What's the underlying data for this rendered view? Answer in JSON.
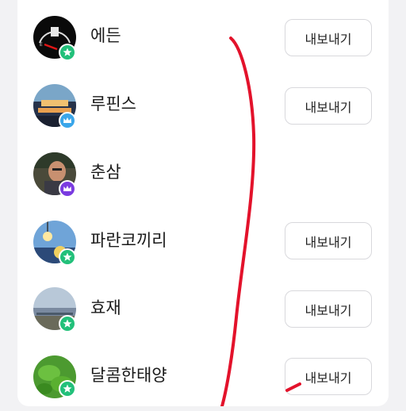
{
  "colors": {
    "background": "#f2f2f4",
    "card": "#ffffff",
    "badge_green": "#22c07a",
    "badge_blue": "#3aa6ea",
    "badge_purple": "#7a3be0",
    "annotation_red": "#e3122b"
  },
  "members": [
    {
      "name": "에든",
      "avatar_icon": "fuel-gauge-avatar",
      "badge_icon": "star-badge-icon",
      "export_label": "내보내기"
    },
    {
      "name": "루핀스",
      "avatar_icon": "night-city-avatar",
      "badge_icon": "crown-blue-badge-icon",
      "export_label": "내보내기"
    },
    {
      "name": "춘삼",
      "avatar_icon": "person-photo-avatar",
      "badge_icon": "crown-purple-badge-icon",
      "export_label": null
    },
    {
      "name": "파란코끼리",
      "avatar_icon": "lamp-sky-avatar",
      "badge_icon": "star-badge-icon",
      "export_label": "내보내기"
    },
    {
      "name": "효재",
      "avatar_icon": "landscape-avatar",
      "badge_icon": "star-badge-icon",
      "export_label": "내보내기"
    },
    {
      "name": "달콤한태양",
      "avatar_icon": "green-leaves-avatar",
      "badge_icon": "star-badge-icon",
      "export_label": "내보내기"
    }
  ]
}
